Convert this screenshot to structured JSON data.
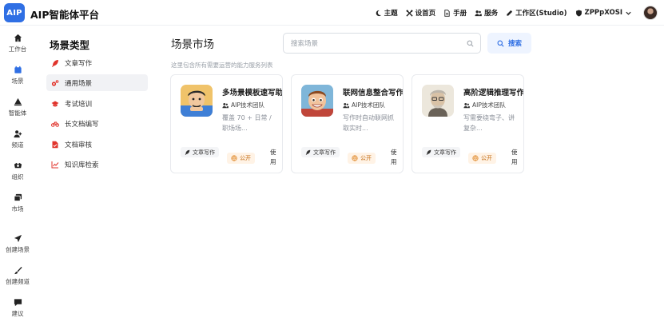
{
  "app": {
    "logo_text": "AIP",
    "title": "AIP智能体平台"
  },
  "topnav": {
    "items": [
      {
        "label": "主题",
        "icon": "moon-icon"
      },
      {
        "label": "设首页",
        "icon": "tools-icon"
      },
      {
        "label": "手册",
        "icon": "doc-icon"
      },
      {
        "label": "服务",
        "icon": "users-icon"
      },
      {
        "label": "工作区(Studio)",
        "icon": "pen-icon"
      },
      {
        "label": "ZPPpXOSI",
        "icon": "shield-icon"
      }
    ]
  },
  "rail": {
    "items": [
      {
        "label": "工作台",
        "icon": "home-icon"
      },
      {
        "label": "场景",
        "icon": "scene-icon"
      },
      {
        "label": "智能体",
        "icon": "agent-icon"
      },
      {
        "label": "频道",
        "icon": "channel-icon"
      },
      {
        "label": "组织",
        "icon": "org-icon"
      },
      {
        "label": "市场",
        "icon": "market-icon"
      },
      {
        "label": "创建场景",
        "icon": "send-icon"
      },
      {
        "label": "创建频道",
        "icon": "brush-icon"
      },
      {
        "label": "建议",
        "icon": "comment-icon"
      }
    ]
  },
  "categories": {
    "title": "场景类型",
    "items": [
      {
        "label": "文章写作",
        "icon": "feather-icon"
      },
      {
        "label": "通用场景",
        "icon": "gears-icon"
      },
      {
        "label": "考试培训",
        "icon": "grad-cap-icon"
      },
      {
        "label": "长文档编写",
        "icon": "bicycle-icon"
      },
      {
        "label": "文档审核",
        "icon": "file-check-icon"
      },
      {
        "label": "知识库检索",
        "icon": "chart-line-icon"
      }
    ]
  },
  "main": {
    "title": "场景市场",
    "search_placeholder": "搜索场景",
    "search_button": "搜索",
    "subtitle": "这里包含所有需要运营的能力服务列表"
  },
  "cards": [
    {
      "title": "多场景模板速写助手",
      "team": "AIP技术团队",
      "desc": "覆盖 70 + 日常 / 职场场...",
      "tag": "文章写作",
      "visibility": "公开",
      "action": "使用",
      "avatar": "cartoon-man-icon"
    },
    {
      "title": "联网信息整合写作",
      "team": "AIP技术团队",
      "desc": "写作时自动联网抓取实时...",
      "tag": "文章写作",
      "visibility": "公开",
      "action": "使用",
      "avatar": "cartoon-boy-icon"
    },
    {
      "title": "高阶逻辑推理写作",
      "team": "AIP技术团队",
      "desc": "写需要绕弯子、讲复杂...",
      "tag": "文章写作",
      "visibility": "公开",
      "action": "使用",
      "avatar": "sketch-man-icon"
    }
  ],
  "colors": {
    "accent": "#2f6fe4",
    "category_icon": "#e0342c",
    "public_tag": "#c36a10"
  }
}
